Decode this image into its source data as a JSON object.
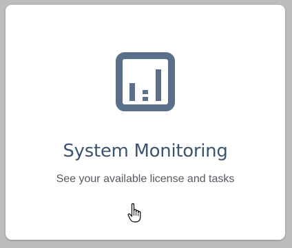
{
  "card": {
    "title": "System Monitoring",
    "description": "See your available license and tasks",
    "icon": "bar-chart-icon"
  },
  "cursor": {
    "icon": "hand-pointer-icon"
  },
  "colors": {
    "icon": "#5a6f8a",
    "title": "#3d5470",
    "description": "#555a60",
    "background": "#bdbdbd",
    "card": "#ffffff"
  }
}
